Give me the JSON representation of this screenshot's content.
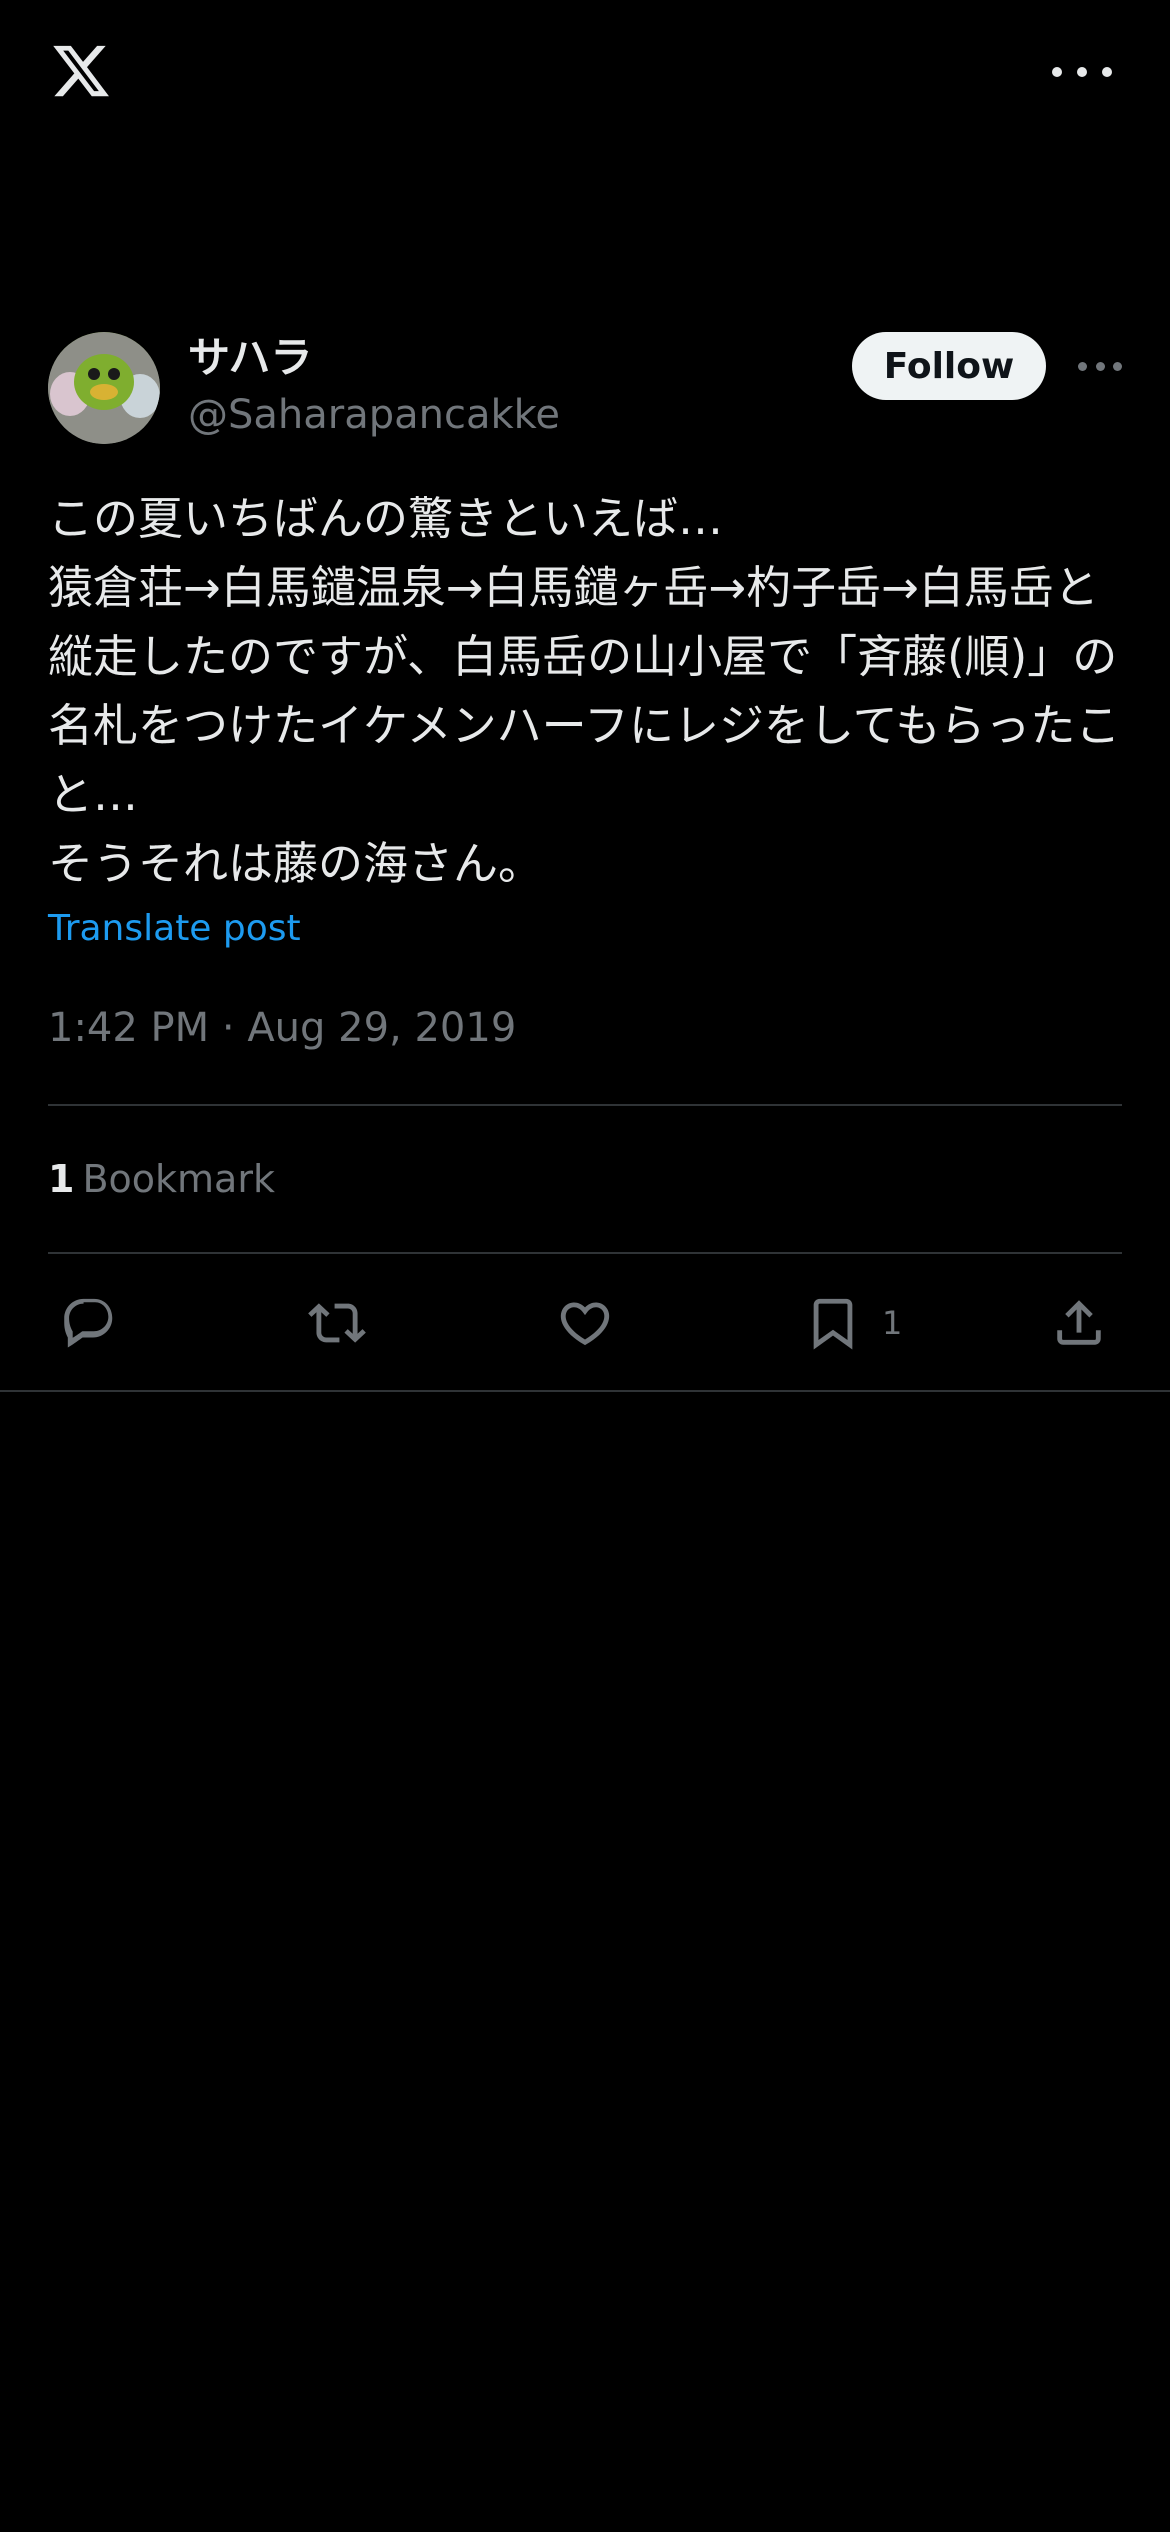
{
  "header": {
    "logo_icon": "x-logo-icon",
    "more_icon": "more-horizontal-icon"
  },
  "author": {
    "name": "サハラ",
    "handle": "@Saharapancakke",
    "avatar_icon": "avatar-image",
    "follow_label": "Follow",
    "more_icon": "more-horizontal-icon"
  },
  "tweet": {
    "text": "この夏いちばんの驚きといえば…\n猿倉荘→白馬鑓温泉→白馬鑓ヶ岳→杓子岳→白馬岳と縦走したのですが、白馬岳の山小屋で「斉藤(順)」の名札をつけたイケメンハーフにレジをしてもらったこと…\nそうそれは藤の海さん。",
    "translate_label": "Translate post",
    "timestamp": "1:42 PM · Aug 29, 2019"
  },
  "stats": {
    "bookmark_count": "1",
    "bookmark_label": "Bookmark"
  },
  "actions": {
    "reply_icon": "reply-icon",
    "repost_icon": "repost-icon",
    "like_icon": "like-icon",
    "bookmark_icon": "bookmark-icon",
    "bookmark_count": "1",
    "share_icon": "share-icon"
  },
  "colors": {
    "background": "#000000",
    "text": "#e7e9ea",
    "secondary": "#71767b",
    "link": "#1d9bf0",
    "divider": "#2f3336",
    "follow_bg": "#eff3f4"
  }
}
